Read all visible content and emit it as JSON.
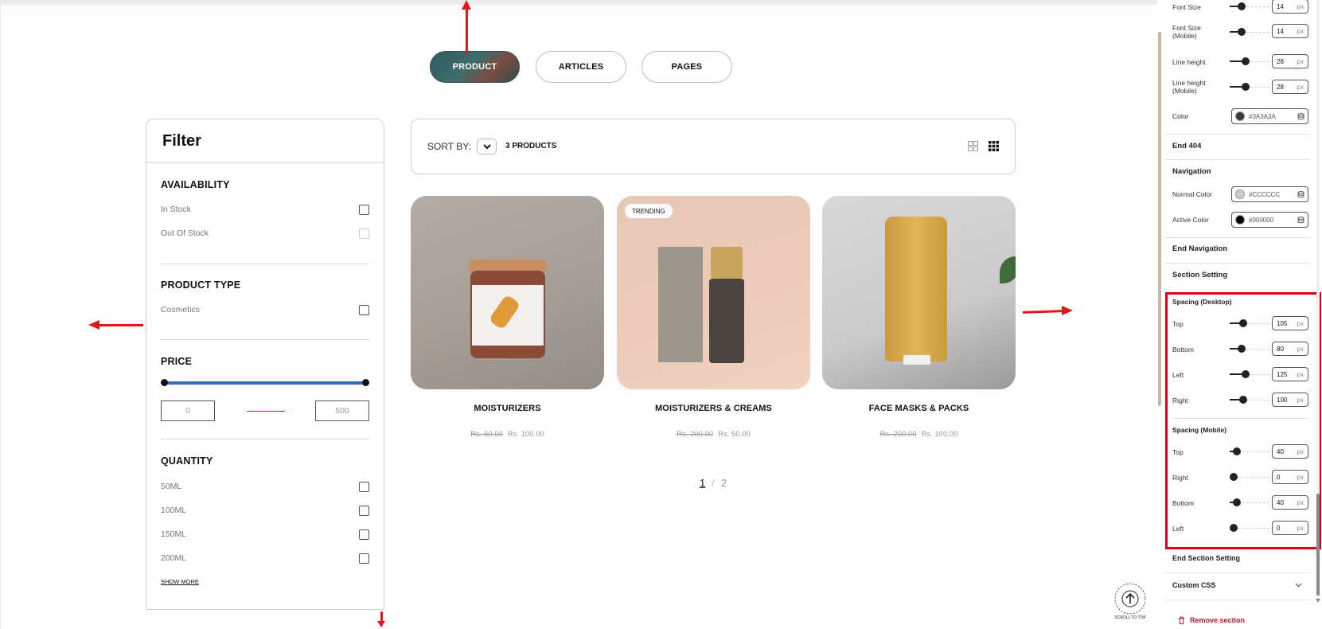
{
  "tabs": [
    {
      "label": "PRODUCT",
      "active": true
    },
    {
      "label": "ARTICLES",
      "active": false
    },
    {
      "label": "PAGES",
      "active": false
    }
  ],
  "filter": {
    "title": "Filter",
    "availability": {
      "heading": "AVAILABILITY",
      "options": [
        "In Stock",
        "Out Of Stock"
      ]
    },
    "product_type": {
      "heading": "PRODUCT TYPE",
      "options": [
        "Cosmetics"
      ]
    },
    "price": {
      "heading": "PRICE",
      "min": "0",
      "max": "500"
    },
    "quantity": {
      "heading": "QUANTITY",
      "options": [
        "50ML",
        "100ML",
        "150ML",
        "200ML"
      ],
      "show_more": "SHOW MORE"
    }
  },
  "sort": {
    "label": "SORT BY:",
    "count": "3 PRODUCTS"
  },
  "products": [
    {
      "name": "MOISTURIZERS",
      "old_price": "Rs. 60.00",
      "price": "Rs. 100.00",
      "badge": ""
    },
    {
      "name": "MOISTURIZERS & CREAMS",
      "old_price": "Rs. 200.00",
      "price": "Rs. 50.00",
      "badge": "TRENDING"
    },
    {
      "name": "FACE MASKS & PACKS",
      "old_price": "Rs. 200.00",
      "price": "Rs. 100.00",
      "badge": ""
    }
  ],
  "pagination": {
    "current": "1",
    "sep": "/",
    "total": "2"
  },
  "scroll_top": "SCROLL TO TOP",
  "panel": {
    "font_size": {
      "label": "Font Size",
      "value": "14",
      "unit": "px"
    },
    "font_size_mobile": {
      "label1": "Font Size",
      "label2": "(Mobile)",
      "value": "14",
      "unit": "px"
    },
    "line_height": {
      "label": "Line height",
      "value": "28",
      "unit": "px"
    },
    "line_height_mobile": {
      "label1": "Line height",
      "label2": "(Mobile)",
      "value": "28",
      "unit": "px"
    },
    "color": {
      "label": "Color",
      "value": "#3A3A3A",
      "swatch": "#3A3A3A"
    },
    "end_404": "End 404",
    "navigation": "Navigation",
    "normal_color": {
      "label": "Normal Color",
      "value": "#CCCCCC",
      "swatch": "#CCCCCC"
    },
    "active_color": {
      "label": "Active Color",
      "value": "#000000",
      "swatch": "#000000"
    },
    "end_navigation": "End Navigation",
    "section_setting": "Section Setting",
    "spacing_desktop": {
      "title": "Spacing (Desktop)",
      "rows": [
        {
          "label": "Top",
          "value": "105",
          "unit": "px"
        },
        {
          "label": "Bottom",
          "value": "80",
          "unit": "px"
        },
        {
          "label": "Left",
          "value": "125",
          "unit": "px"
        },
        {
          "label": "Right",
          "value": "100",
          "unit": "px"
        }
      ]
    },
    "spacing_mobile": {
      "title": "Spacing (Mobile)",
      "rows": [
        {
          "label": "Top",
          "value": "40",
          "unit": "px"
        },
        {
          "label": "Right",
          "value": "0",
          "unit": "px"
        },
        {
          "label": "Bottom",
          "value": "40",
          "unit": "px"
        },
        {
          "label": "Left",
          "value": "0",
          "unit": "px"
        }
      ]
    },
    "end_section_setting": "End Section Setting",
    "custom_css": "Custom CSS",
    "remove_section": "Remove section"
  },
  "colors": {
    "accent_red": "#e01818",
    "price_bar": "#3a66c4",
    "highlight": "#e0001b"
  }
}
